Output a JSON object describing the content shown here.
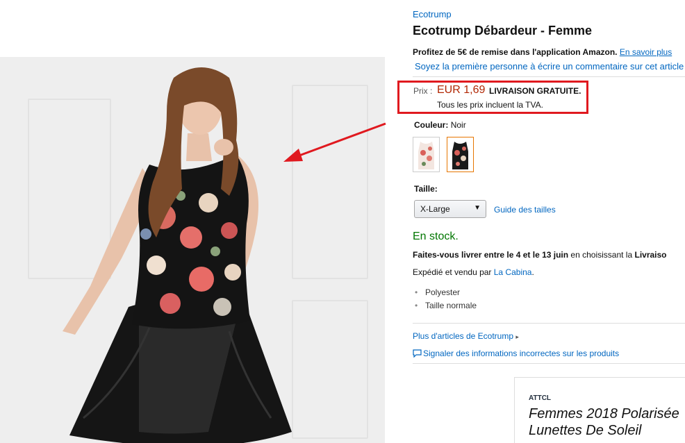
{
  "product": {
    "brand": "Ecotrump",
    "title": "Ecotrump Débardeur - Femme",
    "promo_text": "Profitez de 5€ de remise dans l'application Amazon.",
    "promo_link": "En savoir plus",
    "review_prompt": "Soyez la première personne à écrire un commentaire sur cet article"
  },
  "price": {
    "label": "Prix :",
    "value": "EUR 1,69",
    "shipping": "LIVRAISON GRATUITE.",
    "tax_note": "Tous les prix incluent la TVA."
  },
  "color": {
    "label": "Couleur:",
    "selected": "Noir"
  },
  "size": {
    "label": "Taille:",
    "selected": "X-Large",
    "guide_link": "Guide des tailles"
  },
  "availability": {
    "stock": "En stock.",
    "delivery_prefix": "Faites-vous livrer entre le 4 et le 13 juin",
    "delivery_middle": " en choisissant la ",
    "delivery_suffix": "Livraiso",
    "seller_prefix": "Expédié et vendu par ",
    "seller_name": "La Cabina",
    "seller_suffix": "."
  },
  "features": [
    "Polyester",
    "Taille normale"
  ],
  "links": {
    "more_articles": "Plus d'articles de Ecotrump",
    "report": "Signaler des informations incorrectes sur les produits"
  },
  "ad": {
    "brand": "ATTCL",
    "title_line1": "Femmes 2018 Polarisée",
    "title_line2": "Lunettes De Soleil"
  },
  "colors": {
    "link": "#0066c0",
    "price": "#b12704",
    "stock": "#007600",
    "highlight_border": "#e0191f",
    "arrow": "#e0191f"
  }
}
